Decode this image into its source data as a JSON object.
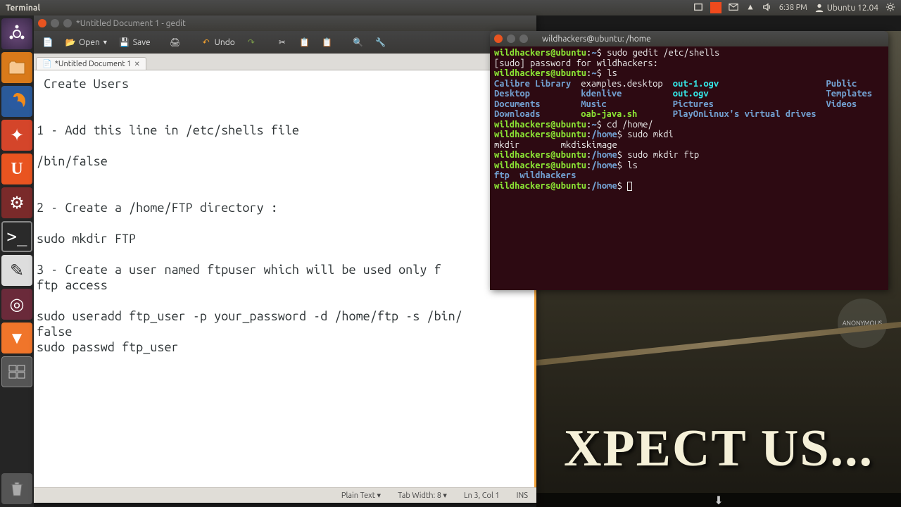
{
  "topbar": {
    "app": "Terminal",
    "time": "6:38 PM",
    "session": "Ubuntu 12.04"
  },
  "gedit": {
    "title": "*Untitled Document 1 - gedit",
    "toolbar": {
      "open": "Open",
      "save": "Save",
      "undo": "Undo"
    },
    "tab": "*Untitled Document 1",
    "content": " Create Users\n\n\n1 - Add this line in /etc/shells file\n\n/bin/false\n\n\n2 - Create a /home/FTP directory :\n\nsudo mkdir FTP\n\n3 - Create a user named ftpuser which will be used only f\nftp access\n\nsudo useradd ftp_user -p your_password -d /home/ftp -s /bin/\nfalse\nsudo passwd ftp_user",
    "status": {
      "lang": "Plain Text ▾",
      "tabw": "Tab Width: 8 ▾",
      "pos": "Ln 3, Col 1",
      "ins": "INS"
    }
  },
  "terminal": {
    "title": "wildhackers@ubuntu: /home",
    "prompt_user": "wildhackers@ubuntu",
    "lines": {
      "l1_cmd": "sudo gedit /etc/shells",
      "l2": "[sudo] password for wildhackers:",
      "l3_cmd": "ls",
      "l4_cmd": "cd /home/",
      "l5_cmd": "sudo mkdi",
      "l6a": "mkdir",
      "l6b": "mkdiskimage",
      "l7_cmd": "sudo mkdir ftp",
      "l8_cmd": "ls",
      "l9a": "ftp",
      "l9b": "wildhackers"
    },
    "ls": {
      "c1": [
        "Calibre Library",
        "Desktop",
        "Documents",
        "Downloads"
      ],
      "c2": [
        "examples.desktop",
        "kdenlive",
        "Music",
        "oab-java.sh"
      ],
      "c3": [
        "out-1.ogv",
        "out.ogv",
        "Pictures",
        "PlayOnLinux's virtual drives"
      ],
      "c4": [
        "Public",
        "Templates",
        "Videos"
      ]
    }
  },
  "wall": {
    "text": "XPECT US...",
    "badge": "ANONYMOUS"
  }
}
